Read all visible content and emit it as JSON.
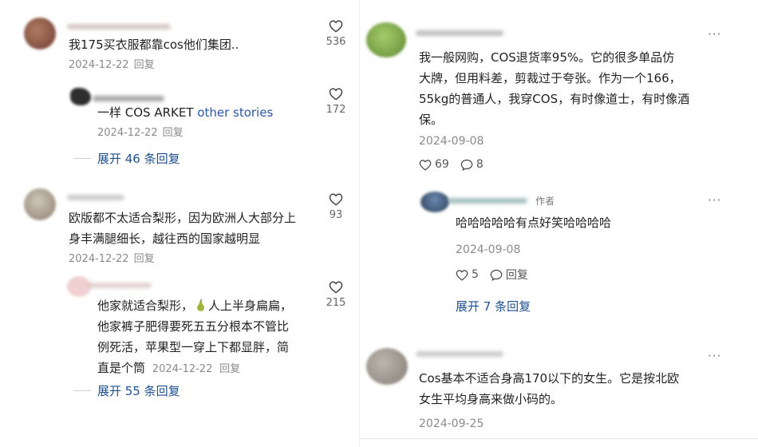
{
  "left": {
    "comments": [
      {
        "text": "我175买衣服都靠cos他们集团..",
        "date": "2024-12-22",
        "reply": "回复",
        "likes": "536",
        "avatar_color": "#8b5a4a"
      },
      {
        "text_prefix": "一样 COS ARKET ",
        "text_link": "other stories",
        "date": "2024-12-22",
        "reply": "回复",
        "likes": "172",
        "avatar_color": "#3a3a3a"
      },
      {
        "expand": "展开 46 条回复"
      },
      {
        "line1": "欧版都不太适合梨形，因为欧洲人大部分上",
        "line2": "身丰满腿细长，越往西的国家越明显",
        "date": "2024-12-22",
        "reply": "回复",
        "likes": "93",
        "avatar_color": "#a89c8c"
      },
      {
        "line1_a": "他家就适合梨形，",
        "line1_b": "人上半身扁扁，",
        "line2": "他家裤子肥得要死五五分根本不管比",
        "line3": "例死活，苹果型一穿上下都显胖，简",
        "line4": "直是个筒",
        "date": "2024-12-22",
        "reply": "回复",
        "likes": "215",
        "avatar_color": "#d9a0a0"
      },
      {
        "expand": "展开 55 条回复"
      }
    ]
  },
  "right": {
    "comments": [
      {
        "line1": "我一般网购，COS退货率95%。它的很多单品仿",
        "line2": "大牌，但用料差，剪裁过于夸张。作为一个166，",
        "line3": "55kg的普通人，我穿COS，有时像道士，有时像酒",
        "line4": "保。",
        "date": "2024-09-08",
        "likes": "69",
        "comments": "8",
        "more": "···",
        "avatar_color": "#7aa84a"
      },
      {
        "text": "哈哈哈哈哈有点好笑哈哈哈哈",
        "author_tag": "作者",
        "date": "2024-09-08",
        "likes": "5",
        "reply": "回复",
        "more": "···",
        "avatar_color": "#4a6a8a"
      },
      {
        "expand": "展开 7 条回复"
      },
      {
        "line1": "Cos基本不适合身高170以下的女生。它是按北欧",
        "line2": "女生平均身高来做小码的。",
        "date": "2024-09-25",
        "more": "···",
        "avatar_color": "#9a948c"
      }
    ]
  },
  "icons": {
    "like": "heart-outline-icon",
    "comment": "comment-bubble-icon",
    "more": "more-dots-icon",
    "emoji": "pear-emoji-icon"
  }
}
